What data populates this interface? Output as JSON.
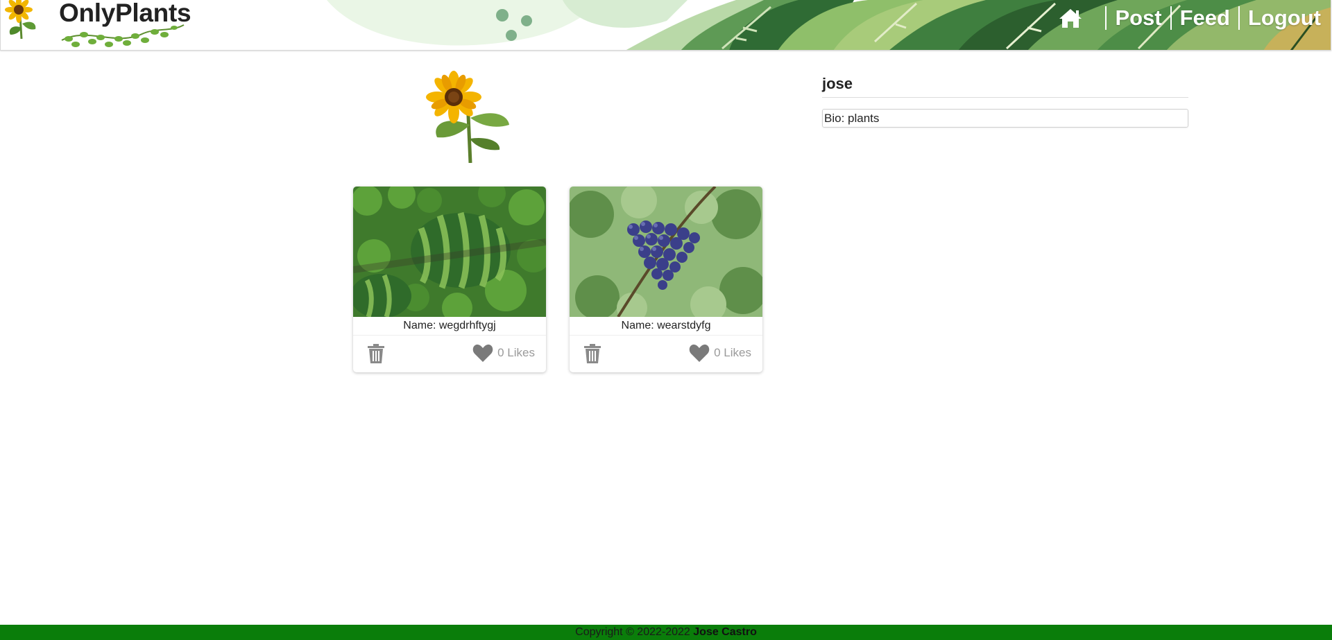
{
  "header": {
    "brand": "OnlyPlants",
    "nav": {
      "home_icon": "home-icon",
      "post_label": "Post",
      "feed_label": "Feed",
      "logout_label": "Logout"
    }
  },
  "profile": {
    "username": "jose",
    "bio": "Bio: plants",
    "avatar_icon": "sunflower-image"
  },
  "posts": [
    {
      "caption": "Name: wegdrhftygj",
      "likes": "0 Likes",
      "image": "watermelon-photo"
    },
    {
      "caption": "Name: wearstdyfg",
      "likes": "0 Likes",
      "image": "grapes-photo"
    }
  ],
  "footer": {
    "copyright": "Copyright © 2022-2022",
    "author": "Jose Castro"
  },
  "colors": {
    "footer_bg": "#0a7d0a",
    "nav_text": "#ffffff",
    "icon_gray": "#8a8a8a"
  }
}
